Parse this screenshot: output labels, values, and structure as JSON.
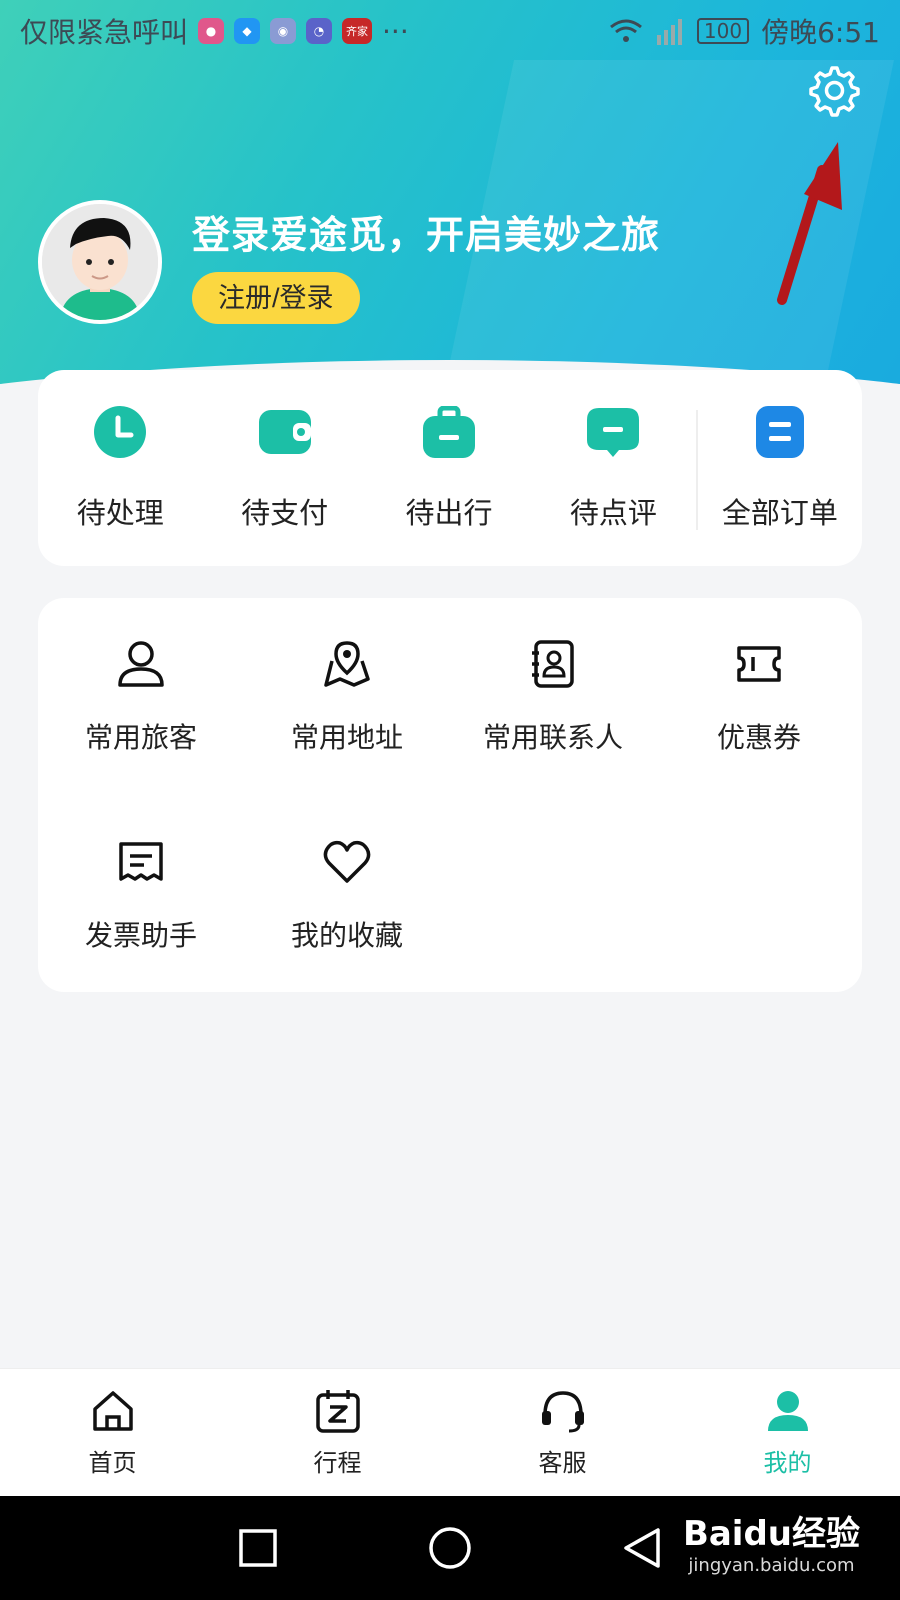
{
  "status_bar": {
    "carrier": "仅限紧急呼叫",
    "more": "···",
    "battery": "100",
    "time": "傍晚6:51",
    "mini_apps": [
      "齐家"
    ]
  },
  "header": {
    "title": "登录爱途觅，开启美妙之旅",
    "login_button": "注册/登录"
  },
  "orders": [
    {
      "label": "待处理",
      "icon": "clock-icon"
    },
    {
      "label": "待支付",
      "icon": "wallet-icon"
    },
    {
      "label": "待出行",
      "icon": "suitcase-icon"
    },
    {
      "label": "待点评",
      "icon": "comment-icon"
    },
    {
      "label": "全部订单",
      "icon": "orders-icon"
    }
  ],
  "tools": [
    {
      "label": "常用旅客",
      "icon": "traveler-icon"
    },
    {
      "label": "常用地址",
      "icon": "map-pin-icon"
    },
    {
      "label": "常用联系人",
      "icon": "contacts-icon"
    },
    {
      "label": "优惠券",
      "icon": "coupon-icon"
    },
    {
      "label": "发票助手",
      "icon": "invoice-icon"
    },
    {
      "label": "我的收藏",
      "icon": "heart-icon"
    }
  ],
  "tabs": [
    {
      "label": "首页",
      "icon": "home-icon"
    },
    {
      "label": "行程",
      "icon": "itinerary-icon"
    },
    {
      "label": "客服",
      "icon": "headset-icon"
    },
    {
      "label": "我的",
      "icon": "user-icon"
    }
  ],
  "watermark": {
    "main": "Baidu经验",
    "sub": "jingyan.baidu.com"
  },
  "colors": {
    "accent": "#1cbfa6",
    "login_button": "#fbd740",
    "all_orders": "#1e88e5"
  }
}
